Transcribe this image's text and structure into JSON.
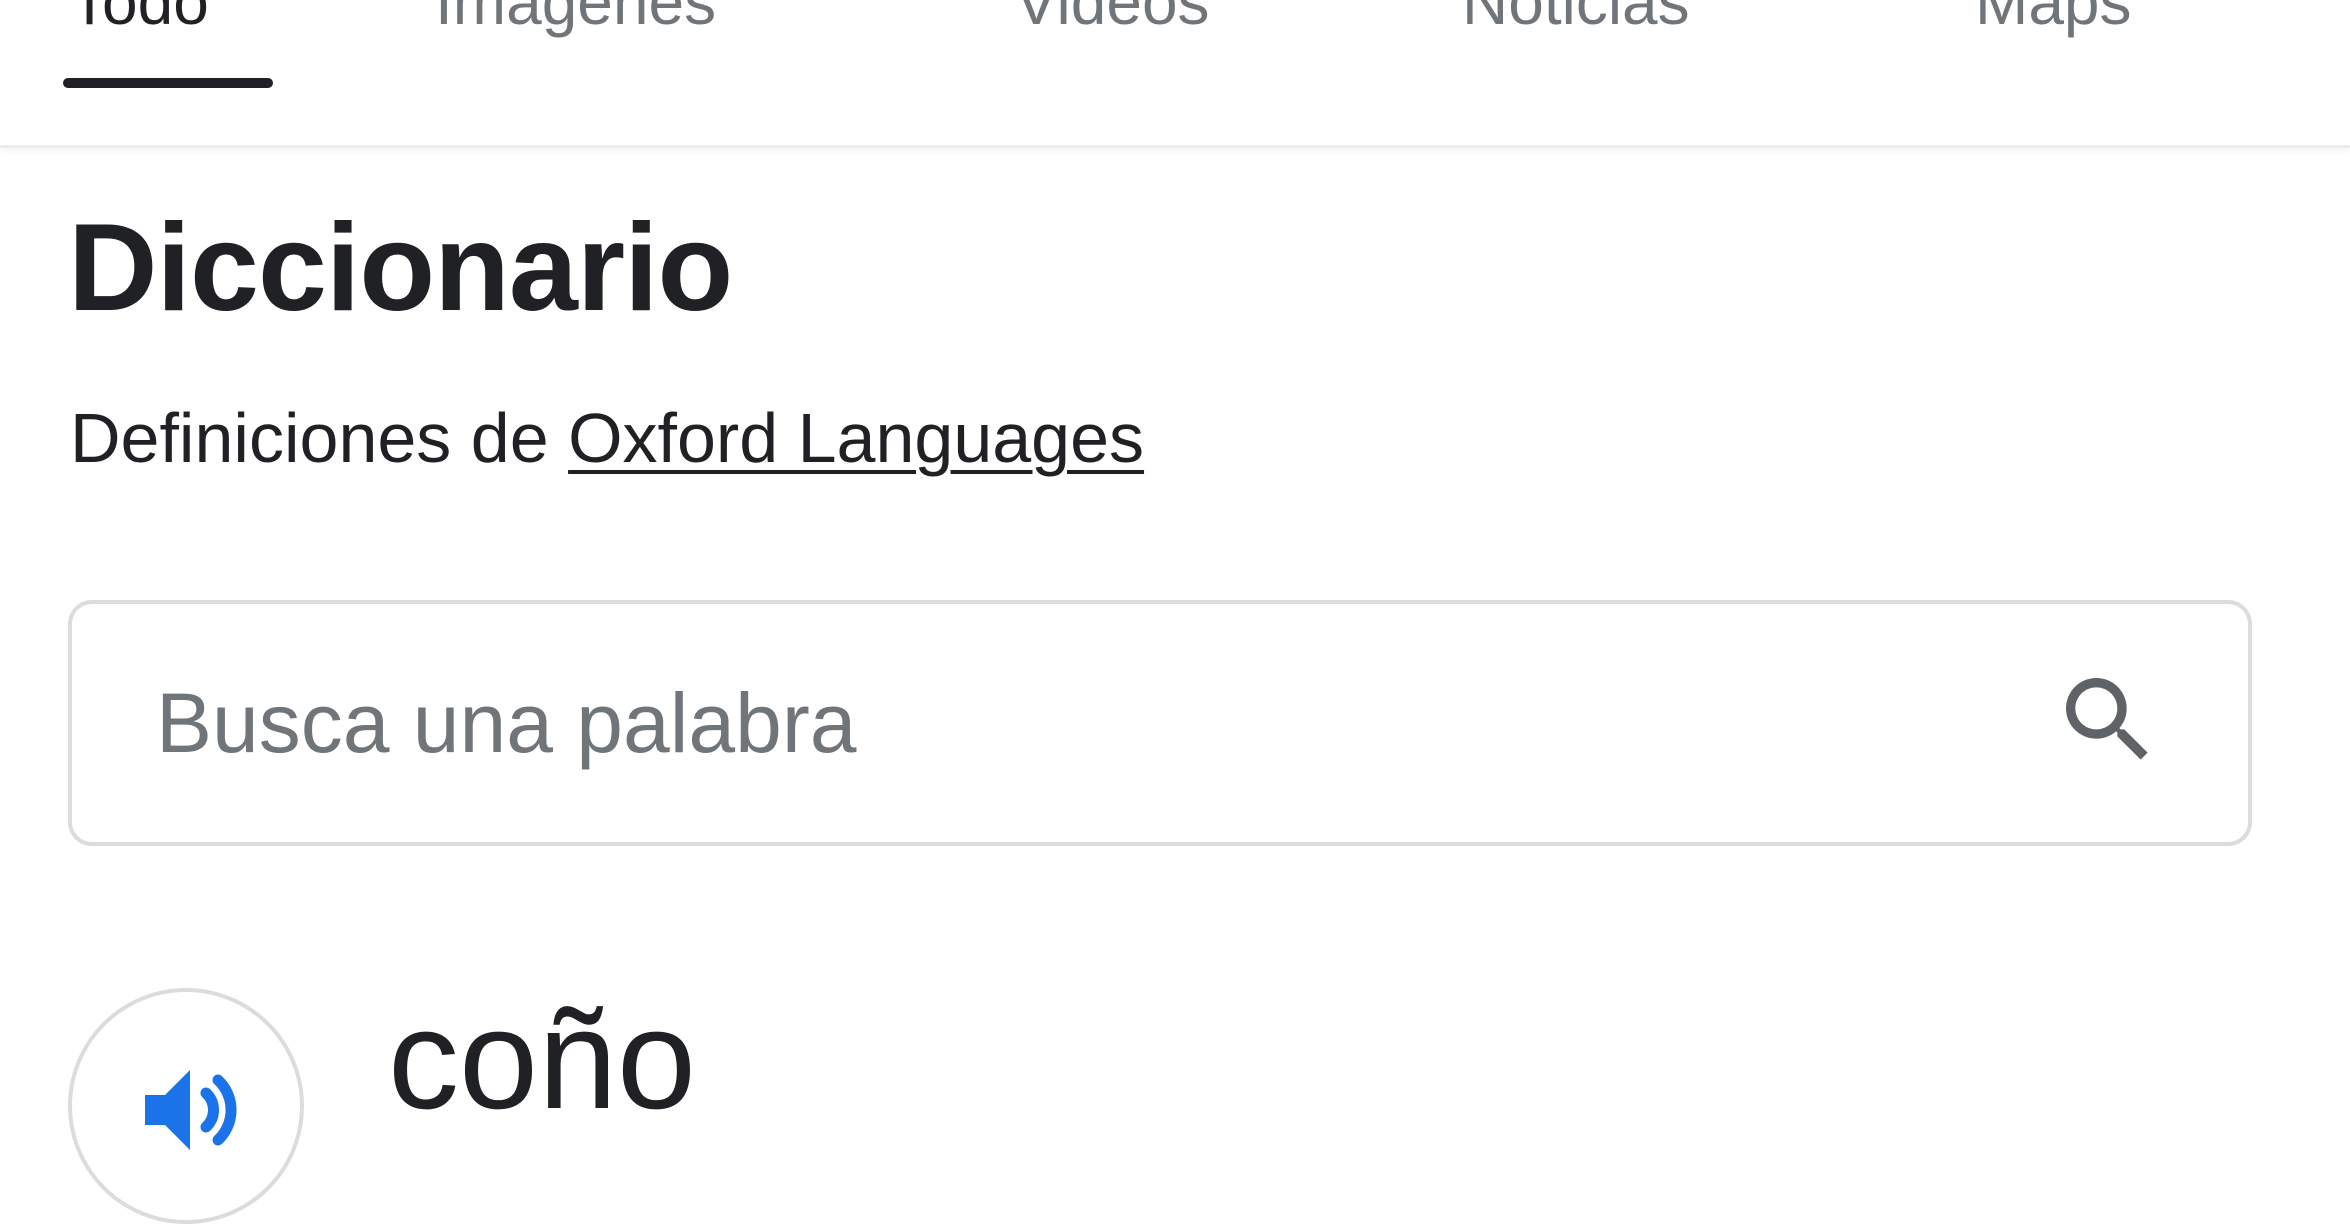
{
  "tabs": [
    {
      "label": "Todo",
      "active": true
    },
    {
      "label": "Imágenes",
      "active": false
    },
    {
      "label": "Videos",
      "active": false
    },
    {
      "label": "Noticias",
      "active": false
    },
    {
      "label": "Maps",
      "active": false
    }
  ],
  "dictionary": {
    "title": "Diccionario",
    "source_prefix": "Definiciones de ",
    "source_link": "Oxford Languages",
    "search": {
      "placeholder": "Busca una palabra",
      "value": "",
      "icon": "search-icon"
    },
    "entry": {
      "word": "coño",
      "audio_icon": "speaker-icon"
    }
  },
  "colors": {
    "text_primary": "#202124",
    "text_secondary": "#70757a",
    "border": "#dadce0",
    "accent_blue": "#1a73e8"
  }
}
